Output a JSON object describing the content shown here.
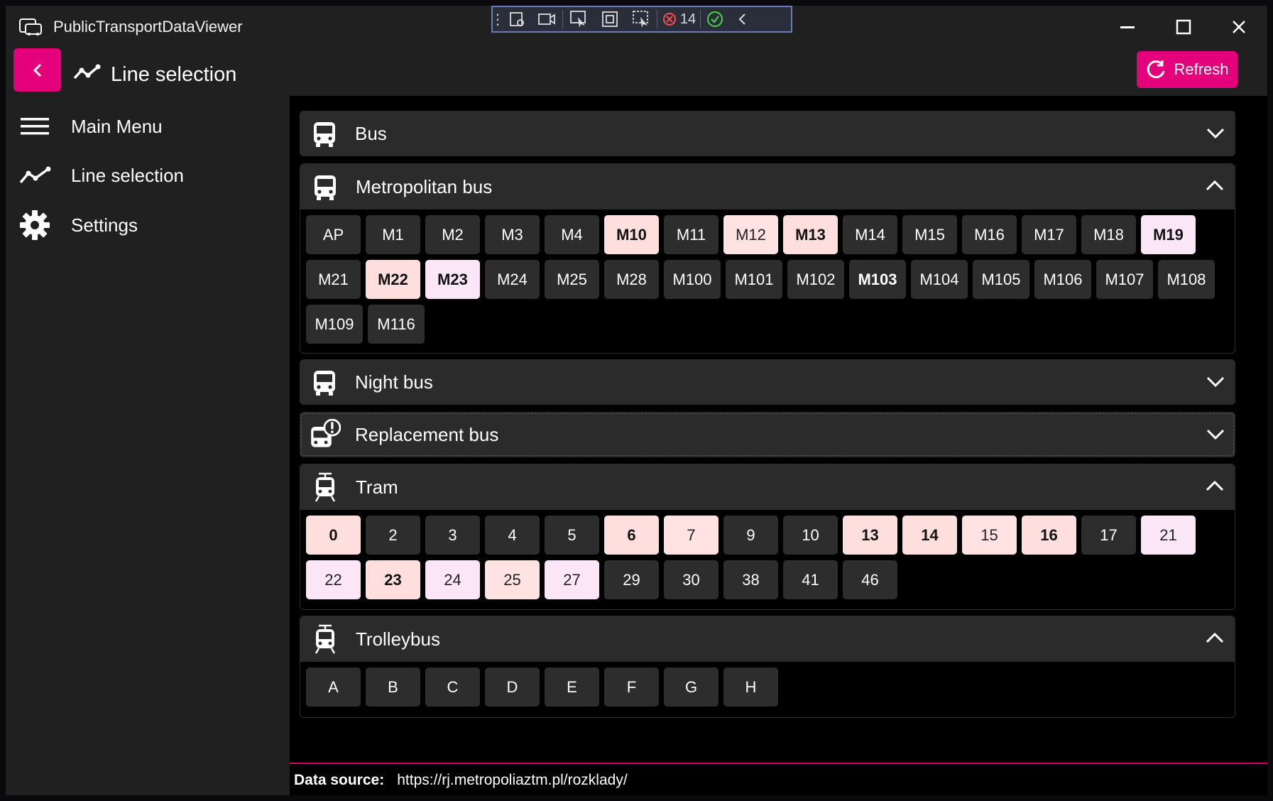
{
  "app": {
    "title": "PublicTransportDataViewer"
  },
  "debug_toolbar": {
    "count": "14"
  },
  "header": {
    "title": "Line selection",
    "refresh_label": "Refresh"
  },
  "nav": [
    {
      "label": "Main Menu",
      "icon": "hamburger-icon"
    },
    {
      "label": "Line selection",
      "icon": "line-chart-icon"
    },
    {
      "label": "Settings",
      "icon": "gear-icon"
    }
  ],
  "sections": [
    {
      "title": "Bus",
      "icon": "bus-icon",
      "expanded": false,
      "lines": []
    },
    {
      "title": "Metropolitan bus",
      "icon": "bus-icon",
      "expanded": true,
      "lines": [
        {
          "n": "AP"
        },
        {
          "n": "M1"
        },
        {
          "n": "M2"
        },
        {
          "n": "M3"
        },
        {
          "n": "M4"
        },
        {
          "n": "M10",
          "s": "pink"
        },
        {
          "n": "M11"
        },
        {
          "n": "M12",
          "s": "pink-light"
        },
        {
          "n": "M13",
          "s": "pink"
        },
        {
          "n": "M14"
        },
        {
          "n": "M15"
        },
        {
          "n": "M16"
        },
        {
          "n": "M17"
        },
        {
          "n": "M18"
        },
        {
          "n": "M19",
          "s": "lav"
        },
        {
          "n": "M21"
        },
        {
          "n": "M22",
          "s": "pink"
        },
        {
          "n": "M23",
          "s": "lav"
        },
        {
          "n": "M24"
        },
        {
          "n": "M25"
        },
        {
          "n": "M28"
        },
        {
          "n": "M100"
        },
        {
          "n": "M101"
        },
        {
          "n": "M102"
        },
        {
          "n": "M103",
          "s": "bold"
        },
        {
          "n": "M104"
        },
        {
          "n": "M105"
        },
        {
          "n": "M106"
        },
        {
          "n": "M107"
        },
        {
          "n": "M108"
        },
        {
          "n": "M109"
        },
        {
          "n": "M116"
        }
      ]
    },
    {
      "title": "Night bus",
      "icon": "bus-icon",
      "expanded": false,
      "lines": []
    },
    {
      "title": "Replacement bus",
      "icon": "replacement-bus-icon",
      "expanded": false,
      "lines": []
    },
    {
      "title": "Tram",
      "icon": "tram-icon",
      "expanded": true,
      "lines": [
        {
          "n": "0",
          "s": "pink"
        },
        {
          "n": "2"
        },
        {
          "n": "3"
        },
        {
          "n": "4"
        },
        {
          "n": "5"
        },
        {
          "n": "6",
          "s": "pink"
        },
        {
          "n": "7",
          "s": "pink-light"
        },
        {
          "n": "9"
        },
        {
          "n": "10"
        },
        {
          "n": "13",
          "s": "pink"
        },
        {
          "n": "14",
          "s": "pink"
        },
        {
          "n": "15",
          "s": "pink-light"
        },
        {
          "n": "16",
          "s": "pink"
        },
        {
          "n": "17"
        },
        {
          "n": "21",
          "s": "lav-light"
        },
        {
          "n": "22",
          "s": "lav-light"
        },
        {
          "n": "23",
          "s": "pink"
        },
        {
          "n": "24",
          "s": "lav-light"
        },
        {
          "n": "25",
          "s": "pink-light"
        },
        {
          "n": "27",
          "s": "lav-light"
        },
        {
          "n": "29"
        },
        {
          "n": "30"
        },
        {
          "n": "38"
        },
        {
          "n": "41"
        },
        {
          "n": "46"
        }
      ]
    },
    {
      "title": "Trolleybus",
      "icon": "tram-icon",
      "expanded": true,
      "lines": [
        {
          "n": "A"
        },
        {
          "n": "B"
        },
        {
          "n": "C"
        },
        {
          "n": "D"
        },
        {
          "n": "E"
        },
        {
          "n": "F"
        },
        {
          "n": "G"
        },
        {
          "n": "H"
        }
      ]
    }
  ],
  "footer": {
    "label": "Data source:",
    "url": "https://rj.metropoliaztm.pl/rozklady/"
  },
  "colors": {
    "accent": "#e3007a"
  }
}
